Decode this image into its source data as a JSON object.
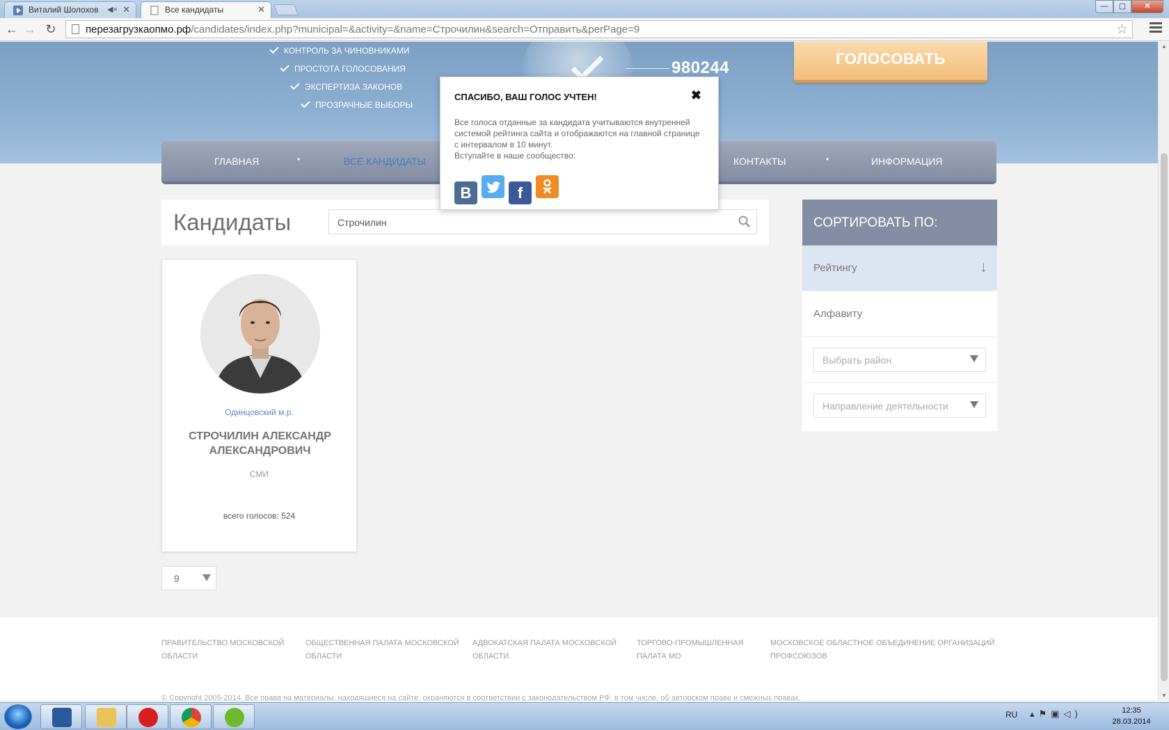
{
  "browser": {
    "tabs": [
      {
        "label": "Виталий Шолохов",
        "muted_indicator": "speaker-muted-icon"
      },
      {
        "label": "Все кандидаты"
      }
    ],
    "url_host": "перезагрузкаопмо.рф",
    "url_path": "/candidates/index.php?municipal=&activity=&name=Строчилин&search=Отправить&perPage=9"
  },
  "hero": {
    "features": [
      "КОНТРОЛЬ ЗА ЧИНОВНИКАМИ",
      "ПРОСТОТА ГОЛОСОВАНИЯ",
      "ЭКСПЕРТИЗА ЗАКОНОВ",
      "ПРОЗРАЧНЫЕ ВЫБОРЫ"
    ],
    "counter": "980244",
    "vote_button": "ГОЛОСОВАТЬ"
  },
  "nav": {
    "items": [
      "ГЛАВНАЯ",
      "ВСЕ КАНДИДАТЫ",
      "КОНТАКТЫ",
      "ИНФОРМАЦИЯ"
    ],
    "separator": "•"
  },
  "candidates": {
    "title": "Кандидаты",
    "search_value": "Строчилин"
  },
  "sort": {
    "heading": "СОРТИРОВАТЬ ПО:",
    "options": [
      "Рейтингу",
      "Алфавиту"
    ],
    "district_placeholder": "Выбрать район",
    "activity_placeholder": "Направление деятельности"
  },
  "card": {
    "district": "Одинцовский м.р.",
    "name_line1": "СТРОЧИЛИН АЛЕКСАНДР",
    "name_line2": "АЛЕКСАНДРОВИЧ",
    "activity": "СМИ",
    "votes_label": "всего голосов:",
    "votes_value": "524"
  },
  "per_page": "9",
  "popup": {
    "title": "СПАСИБО, ВАШ ГОЛОС УЧТЕН!",
    "close": "✖",
    "text": "Все голоса отданные за кандидата учитываются внутренней системой рейтинга сайта и отображаются на главной странице с интервалом в 10 минут.",
    "join": "Вступайте в наше сообщество:",
    "socials": [
      "vk-icon",
      "twitter-icon",
      "facebook-icon",
      "odnoklassniki-icon"
    ]
  },
  "footer": {
    "links": [
      {
        "l1": "ПРАВИТЕЛЬСТВО МОСКОВСКОЙ",
        "l2": "ОБЛАСТИ"
      },
      {
        "l1": "ОБЩЕСТВЕННАЯ ПАЛАТА МОСКОВСКОЙ",
        "l2": "ОБЛАСТИ"
      },
      {
        "l1": "АДВОКАТСКАЯ ПАЛАТА МОСКОВСКОЙ",
        "l2": "ОБЛАСТИ"
      },
      {
        "l1": "ТОРГОВО-ПРОМЫШЛЕННАЯ",
        "l2": "ПАЛАТА МО"
      },
      {
        "l1": "МОСКОВСКОЕ ОБЛАСТНОЕ ОБЪЕДИНЕНИЕ ОРГАНИЗАЦИЙ",
        "l2": "ПРОФСОЮЗОВ"
      }
    ],
    "copyright": "© Copyright 2005-2014. Все права на материалы, находящиеся на сайте, охраняются в соответствии с законодательством РФ, в том числе, об авторском праве и смежных правах."
  },
  "taskbar": {
    "language": "RU",
    "time": "12:35",
    "date": "28.03.2014"
  },
  "colors": {
    "accent_blue": "#5b8ac0",
    "nav_bg": "#848da4",
    "vote_orange": "#f2bd7b"
  }
}
